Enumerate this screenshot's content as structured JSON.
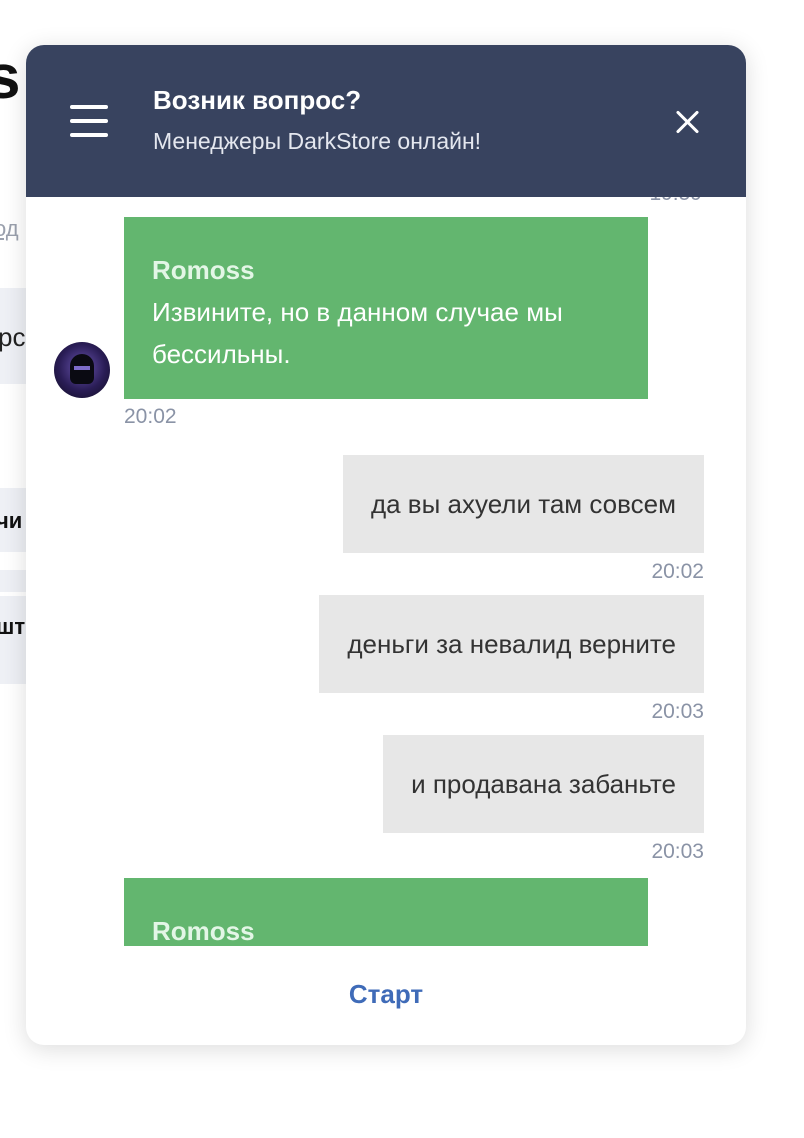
{
  "background_page": {
    "glyph": "s",
    "link_fragment": "од",
    "field_fragment": "pc",
    "row1_fragment": "чи",
    "row3_fragment": "шт"
  },
  "header": {
    "title": "Возник вопрос?",
    "subtitle": "Менеджеры DarkStore онлайн!",
    "menu_icon": "hamburger-icon",
    "close_icon": "close-icon",
    "background_color": "#38435f"
  },
  "messages": [
    {
      "direction": "incoming",
      "sender": "Romoss",
      "text": "Извините, но в данном случае мы бессильны.",
      "time": "20:02"
    },
    {
      "direction": "outgoing",
      "text": "да вы ахуели там совсем",
      "time": "20:02"
    },
    {
      "direction": "outgoing",
      "text": "деньги за невалид верните",
      "time": "20:03"
    },
    {
      "direction": "outgoing",
      "text": "и продавана забаньте",
      "time": "20:03"
    },
    {
      "direction": "incoming",
      "sender": "Romoss",
      "text": "",
      "time": ""
    }
  ],
  "footer": {
    "start_label": "Старт"
  },
  "colors": {
    "incoming_bubble": "#63b66f",
    "outgoing_bubble": "#e7e7e7",
    "start_link": "#3f6bb8",
    "timestamp": "#8a93a6"
  }
}
